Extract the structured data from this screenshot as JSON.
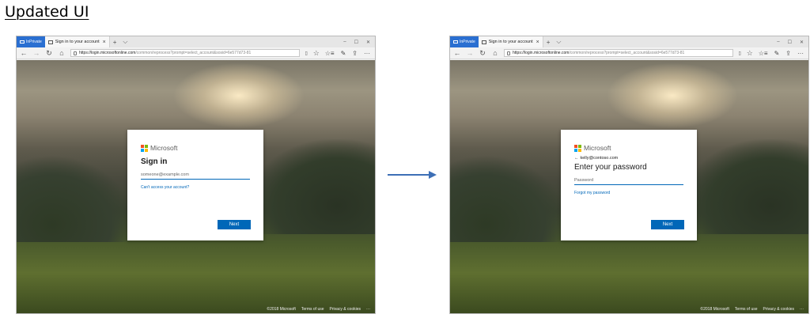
{
  "heading": "Updated UI",
  "browsers": [
    {
      "inprivate_label": "InPrivate",
      "tab_title": "Sign in to your account",
      "tab_close": "×",
      "new_tab": "+",
      "tab_menu": "⌵",
      "win_minimize": "–",
      "win_maximize": "☐",
      "win_close": "✕",
      "url_host": "https://login.microsoftonline.com",
      "url_path": "/common/reprocess?prompt=select_account&sosid=6e577d73-81",
      "card": {
        "brand": "Microsoft",
        "title": "Sign in",
        "placeholder": "someone@example.com",
        "link": "Can't access your account?",
        "button": "Next"
      },
      "footer": {
        "copyright": "©2018 Microsoft",
        "terms": "Terms of use",
        "privacy": "Privacy & cookies",
        "more": "···"
      }
    },
    {
      "inprivate_label": "InPrivate",
      "tab_title": "Sign in to your account",
      "tab_close": "×",
      "new_tab": "+",
      "tab_menu": "⌵",
      "win_minimize": "–",
      "win_maximize": "☐",
      "win_close": "✕",
      "url_host": "https://login.microsoftonline.com",
      "url_path": "/common/reprocess?prompt=select_account&sosid=6e577d73-81",
      "card": {
        "brand": "Microsoft",
        "identity": "kelly@contoso.com",
        "title": "Enter your password",
        "placeholder": "Password",
        "link": "Forgot my password",
        "button": "Next"
      },
      "footer": {
        "copyright": "©2018 Microsoft",
        "terms": "Terms of use",
        "privacy": "Privacy & cookies",
        "more": "···"
      }
    }
  ],
  "colors": {
    "accent": "#0067b8",
    "inprivate": "#2a6fd1",
    "arrow": "#3d6fb6"
  },
  "icons": [
    "back-arrow-icon",
    "forward-arrow-icon",
    "refresh-icon",
    "home-icon",
    "lock-icon",
    "reading-view-icon",
    "favorite-star-icon",
    "favorites-hub-icon",
    "notes-pen-icon",
    "share-icon",
    "more-icon"
  ]
}
